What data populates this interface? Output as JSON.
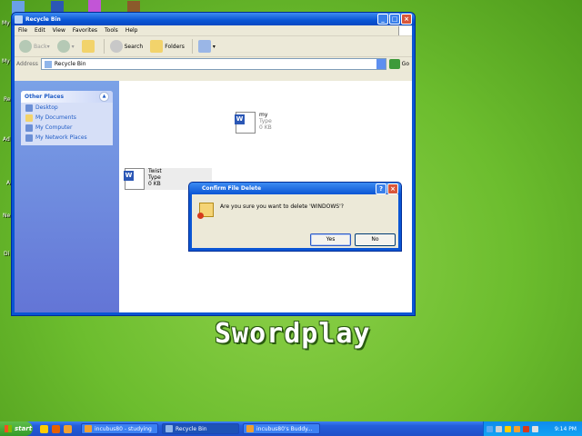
{
  "window": {
    "title": "Recycle Bin",
    "menu": [
      "File",
      "Edit",
      "View",
      "Favorites",
      "Tools",
      "Help"
    ],
    "toolbar": {
      "back": "Back",
      "search": "Search",
      "folders": "Folders"
    },
    "address": {
      "label": "Address",
      "value": "Recycle Bin",
      "go": "Go"
    }
  },
  "other_places": {
    "title": "Other Places",
    "items": [
      "Desktop",
      "My Documents",
      "My Computer",
      "My Network Places"
    ]
  },
  "files": [
    {
      "name": "my",
      "type": "Type",
      "size": "0 KB"
    },
    {
      "name": "Twist",
      "type": "Type",
      "size": "0 KB"
    }
  ],
  "dialog": {
    "title": "Confirm File Delete",
    "message": "Are you sure you want to delete 'WINDOWS'?",
    "yes": "Yes",
    "no": "No"
  },
  "desktop": {
    "labels": [
      "My",
      "My",
      "Re",
      "Ad",
      "A",
      "Ne",
      "Di"
    ],
    "wallpaper_text": "Swordplay"
  },
  "taskbar": {
    "start": "start",
    "tasks": [
      "incubus80 - studying",
      "Recycle Bin",
      "incubus80's Buddy..."
    ],
    "clock": "9:14 PM"
  },
  "colors": {
    "xp_blue": "#0a55d4",
    "desktop_green": "#6cbd2e",
    "start_green": "#339a29"
  }
}
